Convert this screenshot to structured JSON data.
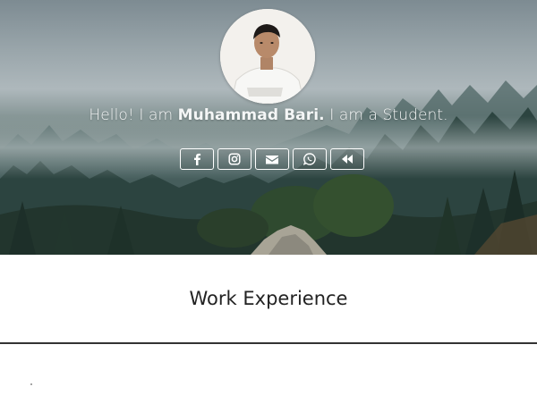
{
  "hero": {
    "greeting": "Hello! I am ",
    "name": "Muhammad Bari.",
    "suffix": " I am a Student."
  },
  "socials": [
    {
      "icon": "facebook-icon"
    },
    {
      "icon": "instagram-icon"
    },
    {
      "icon": "envelope-icon"
    },
    {
      "icon": "whatsapp-icon"
    },
    {
      "icon": "backward-icon"
    }
  ],
  "sections": {
    "work_title": "Work Experience"
  },
  "colors": {
    "hero_text": "#f4f6f6",
    "forest_dark": "#1f3330",
    "divider": "#333333"
  }
}
